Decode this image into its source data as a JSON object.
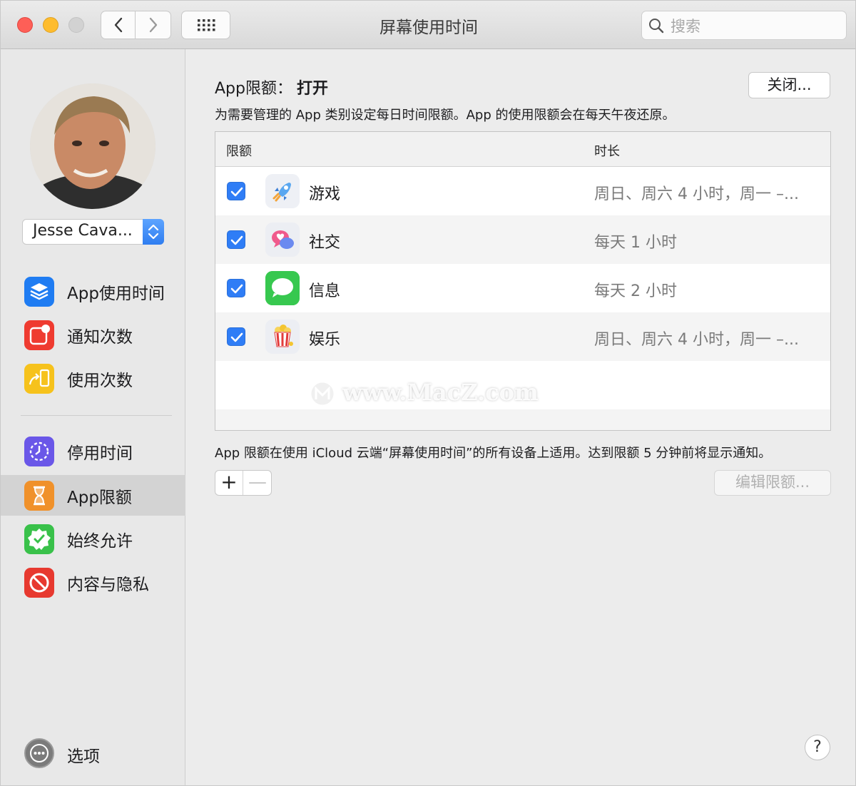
{
  "window": {
    "title": "屏幕使用时间"
  },
  "search": {
    "placeholder": "搜索"
  },
  "sidebar": {
    "user_name": "Jesse Cava...",
    "items": [
      {
        "label": "App使用时间",
        "icon": "layers-icon",
        "color": "#1f7cf2"
      },
      {
        "label": "通知次数",
        "icon": "notification-icon",
        "color": "#ef3b30"
      },
      {
        "label": "使用次数",
        "icon": "pickup-icon",
        "color": "#f6c21c"
      },
      {
        "label": "停用时间",
        "icon": "downtime-icon",
        "color": "#6a57e8"
      },
      {
        "label": "App限额",
        "icon": "hourglass-icon",
        "color": "#f0912a"
      },
      {
        "label": "始终允许",
        "icon": "check-badge-icon",
        "color": "#39c14a"
      },
      {
        "label": "内容与隐私",
        "icon": "restriction-icon",
        "color": "#e7392f"
      }
    ],
    "selected": "App限额",
    "options_label": "选项"
  },
  "main": {
    "limit_label": "App限额：",
    "limit_state": "打开",
    "off_button": "关闭...",
    "description": "为需要管理的 App 类别设定每日时间限额。App 的使用限额会在每天午夜还原。",
    "table": {
      "col_limit": "限额",
      "col_duration": "时长",
      "rows": [
        {
          "checked": true,
          "name": "游戏",
          "duration": "周日、周六 4 小时，周一 –...",
          "icon": "rocket-icon"
        },
        {
          "checked": true,
          "name": "社交",
          "duration": "每天 1 小时",
          "icon": "social-icon"
        },
        {
          "checked": true,
          "name": "信息",
          "duration": "每天 2 小时",
          "icon": "messages-icon"
        },
        {
          "checked": true,
          "name": "娱乐",
          "duration": "周日、周六 4 小时，周一 –...",
          "icon": "popcorn-icon"
        }
      ]
    },
    "watermark": "www.MacZ.com",
    "footnote": "App 限额在使用 iCloud 云端“屏幕使用时间”的所有设备上适用。达到限额 5 分钟前将显示通知。",
    "plus_label": "+",
    "minus_label": "—",
    "edit_button": "编辑限额...",
    "help_label": "?"
  }
}
